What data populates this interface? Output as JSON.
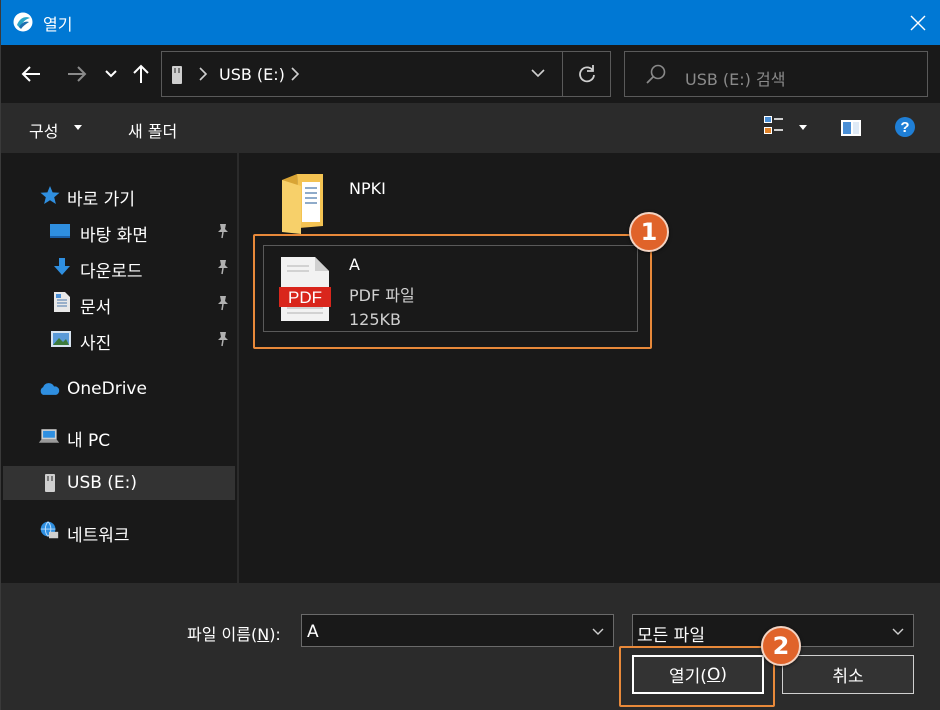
{
  "window": {
    "title": "열기"
  },
  "colors": {
    "titlebar": "#0078d4",
    "accent_highlight": "#e8893a",
    "badge": "#e0632a",
    "pdf_red": "#d9261c",
    "folder_yellow": "#f4c352"
  },
  "address": {
    "crumb": "USB (E:)"
  },
  "search": {
    "placeholder": "USB (E:) 검색"
  },
  "toolbar": {
    "organize_label": "구성",
    "new_folder_label": "새 폴더"
  },
  "sidebar": {
    "items": [
      {
        "label": "바로 가기",
        "icon": "star-icon"
      },
      {
        "label": "바탕 화면",
        "icon": "desktop-icon",
        "pinned": true
      },
      {
        "label": "다운로드",
        "icon": "download-arrow-icon",
        "pinned": true
      },
      {
        "label": "문서",
        "icon": "document-icon",
        "pinned": true
      },
      {
        "label": "사진",
        "icon": "pictures-icon",
        "pinned": true
      },
      {
        "label": "OneDrive",
        "icon": "cloud-icon"
      },
      {
        "label": "내 PC",
        "icon": "computer-icon"
      },
      {
        "label": "USB (E:)",
        "icon": "usb-drive-icon",
        "selected": true
      },
      {
        "label": "네트워크",
        "icon": "network-icon"
      }
    ]
  },
  "files": [
    {
      "name": "NPKI",
      "icon": "folder-icon"
    },
    {
      "name": "A",
      "type": "PDF 파일",
      "size": "125KB",
      "icon": "pdf-file-icon",
      "icon_text": "PDF"
    }
  ],
  "footer": {
    "filename_label": "파일 이름(",
    "filename_mnemonic": "N",
    "filename_label_end": "):",
    "filename_value": "A",
    "filetype_value": "모든 파일",
    "open_label": "열기(",
    "open_mnemonic": "O",
    "open_label_end": ")",
    "cancel_label": "취소"
  },
  "annotations": {
    "badge1": "1",
    "badge2": "2"
  }
}
